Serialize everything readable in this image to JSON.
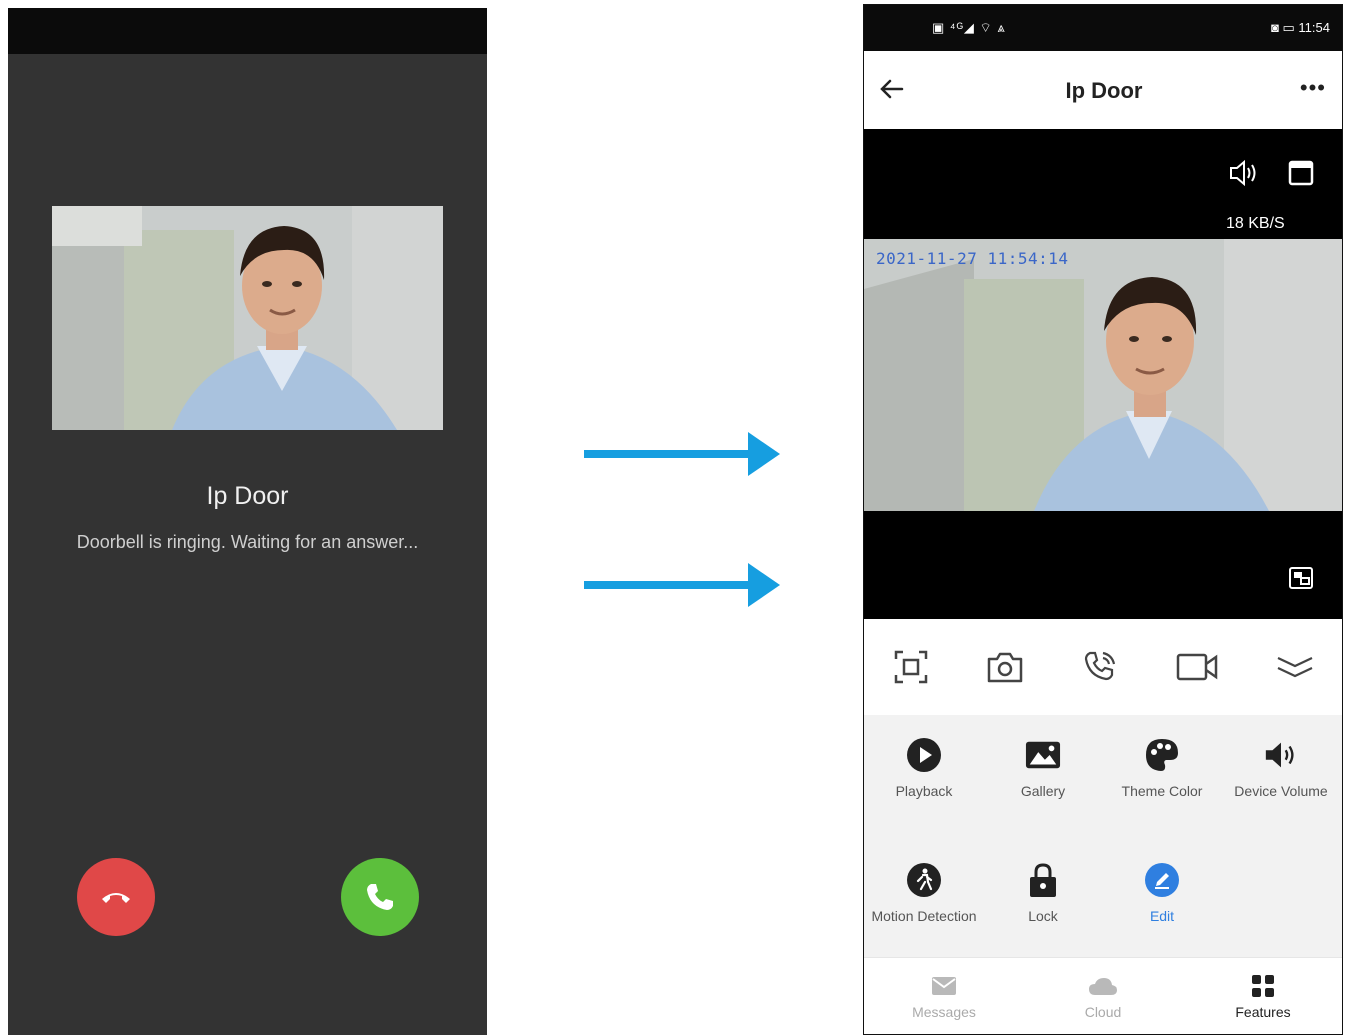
{
  "call_screen": {
    "caller_name": "Ip Door",
    "status_text": "Doorbell is ringing. Waiting for an answer..."
  },
  "app": {
    "status_bar": {
      "left_icons": "▣ ⁴ᴳ◢ ⌔ ⩓",
      "right_icons": "◙ ▭ 11:54"
    },
    "title": "Ip Door",
    "bitrate": "18 KB/S",
    "timestamp": "2021-11-27  11:54:14",
    "features": [
      {
        "label": "Playback",
        "icon": "play-circle-icon"
      },
      {
        "label": "Gallery",
        "icon": "gallery-icon"
      },
      {
        "label": "Theme Color",
        "icon": "palette-icon"
      },
      {
        "label": "Device Volume",
        "icon": "volume-icon"
      },
      {
        "label": "Motion Detection",
        "icon": "motion-icon"
      },
      {
        "label": "Lock",
        "icon": "lock-icon"
      },
      {
        "label": "Edit",
        "icon": "edit-icon"
      }
    ],
    "nav": [
      {
        "label": "Messages",
        "icon": "messages-icon"
      },
      {
        "label": "Cloud",
        "icon": "cloud-icon"
      },
      {
        "label": "Features",
        "icon": "features-grid-icon"
      }
    ],
    "colors": {
      "accent": "#2f7fe0",
      "arrow": "#169ee0",
      "decline": "#e04848",
      "answer": "#5cbf3c"
    }
  }
}
